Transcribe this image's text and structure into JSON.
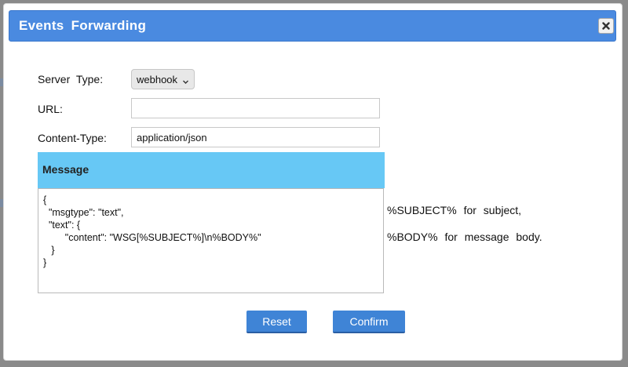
{
  "dialog": {
    "title": "Events  Forwarding",
    "close_icon": "close-icon"
  },
  "form": {
    "server_type": {
      "label": "Server  Type:",
      "value": "webhook"
    },
    "url": {
      "label": "URL:",
      "value": ""
    },
    "content_type": {
      "label": "Content-Type:",
      "value": "application/json"
    }
  },
  "message": {
    "header": "Message",
    "body": "{\n  \"msgtype\": \"text\",\n  \"text\": {\n        \"content\": \"WSG[%SUBJECT%]\\n%BODY%\"\n   }\n}"
  },
  "hints": {
    "subject": "%SUBJECT%  for  subject,",
    "body": "%BODY%  for  message  body."
  },
  "buttons": {
    "reset": "Reset",
    "confirm": "Confirm"
  },
  "colors": {
    "titlebar": "#4a8ae0",
    "message_header": "#67c8f5",
    "button": "#3f84d6"
  }
}
